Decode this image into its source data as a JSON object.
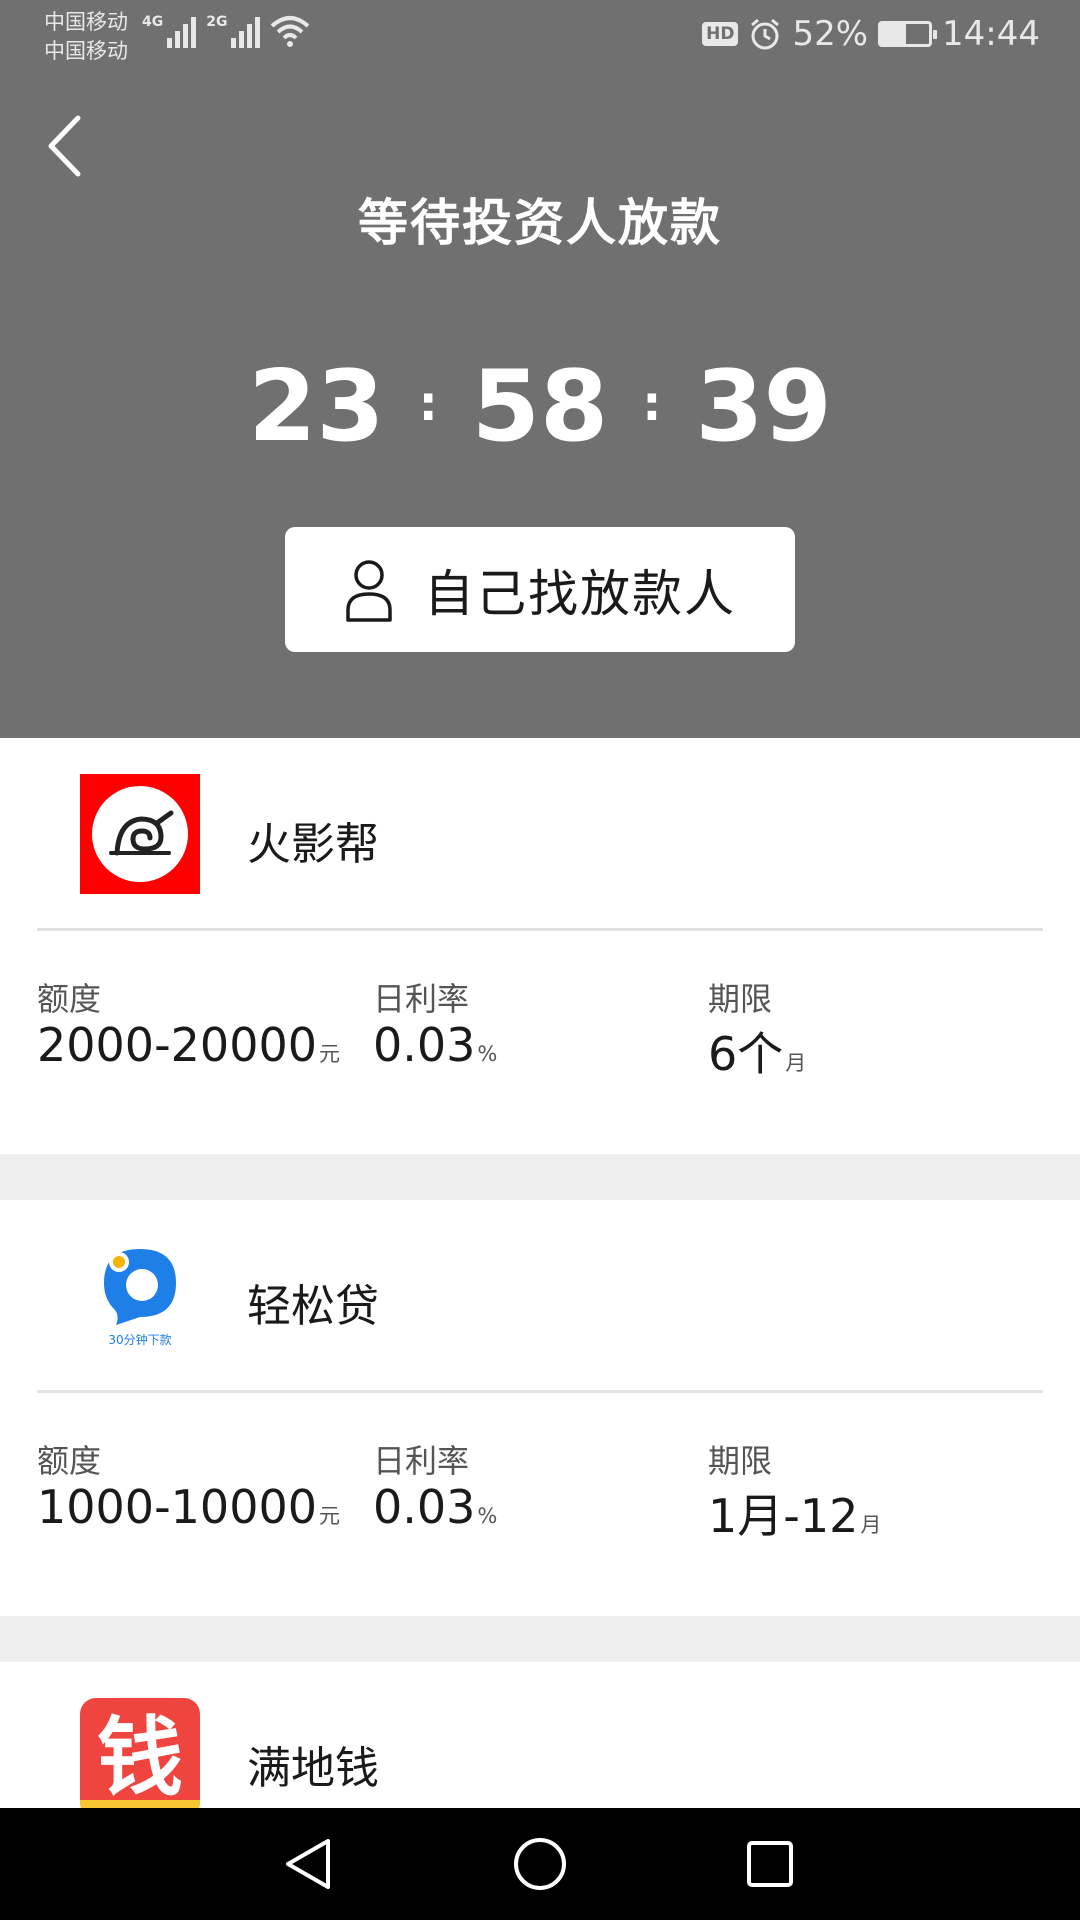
{
  "status_bar": {
    "carrier_1": "中国移动",
    "carrier_2": "中国移动",
    "net_1": "4G",
    "net_2": "2G",
    "hd": "HD",
    "battery_percent": "52%",
    "battery_level": 0.52,
    "time": "14:44"
  },
  "header": {
    "title": "等待投资人放款",
    "countdown": {
      "hours": "23",
      "minutes": "58",
      "seconds": "39",
      "separator": ":"
    },
    "self_find_button": "自己找放款人"
  },
  "products": [
    {
      "name": "火影帮",
      "logo_icon": "leaf-swirl-logo",
      "amount_label": "额度",
      "amount_value": "2000-20000",
      "amount_unit": "元",
      "rate_label": "日利率",
      "rate_value": "0.03",
      "rate_unit": "%",
      "term_label": "期限",
      "term_value": "6个",
      "term_unit": "月"
    },
    {
      "name": "轻松贷",
      "logo_icon": "blue-bubble-logo",
      "logo_caption": "30分钟下款",
      "amount_label": "额度",
      "amount_value": "1000-10000",
      "amount_unit": "元",
      "rate_label": "日利率",
      "rate_value": "0.03",
      "rate_unit": "%",
      "term_label": "期限",
      "term_value": "1月-12",
      "term_unit": "月"
    },
    {
      "name": "满地钱",
      "logo_icon": "money-logo",
      "logo_text": "钱"
    }
  ],
  "colors": {
    "header_bg": "#707070",
    "page_bg": "#ffffff",
    "separator_bg": "#efefef",
    "logo_red": "#ff0000",
    "logo_blue": "#1f7fe8",
    "money_red": "#f0453f",
    "nav_bg": "#000000"
  }
}
